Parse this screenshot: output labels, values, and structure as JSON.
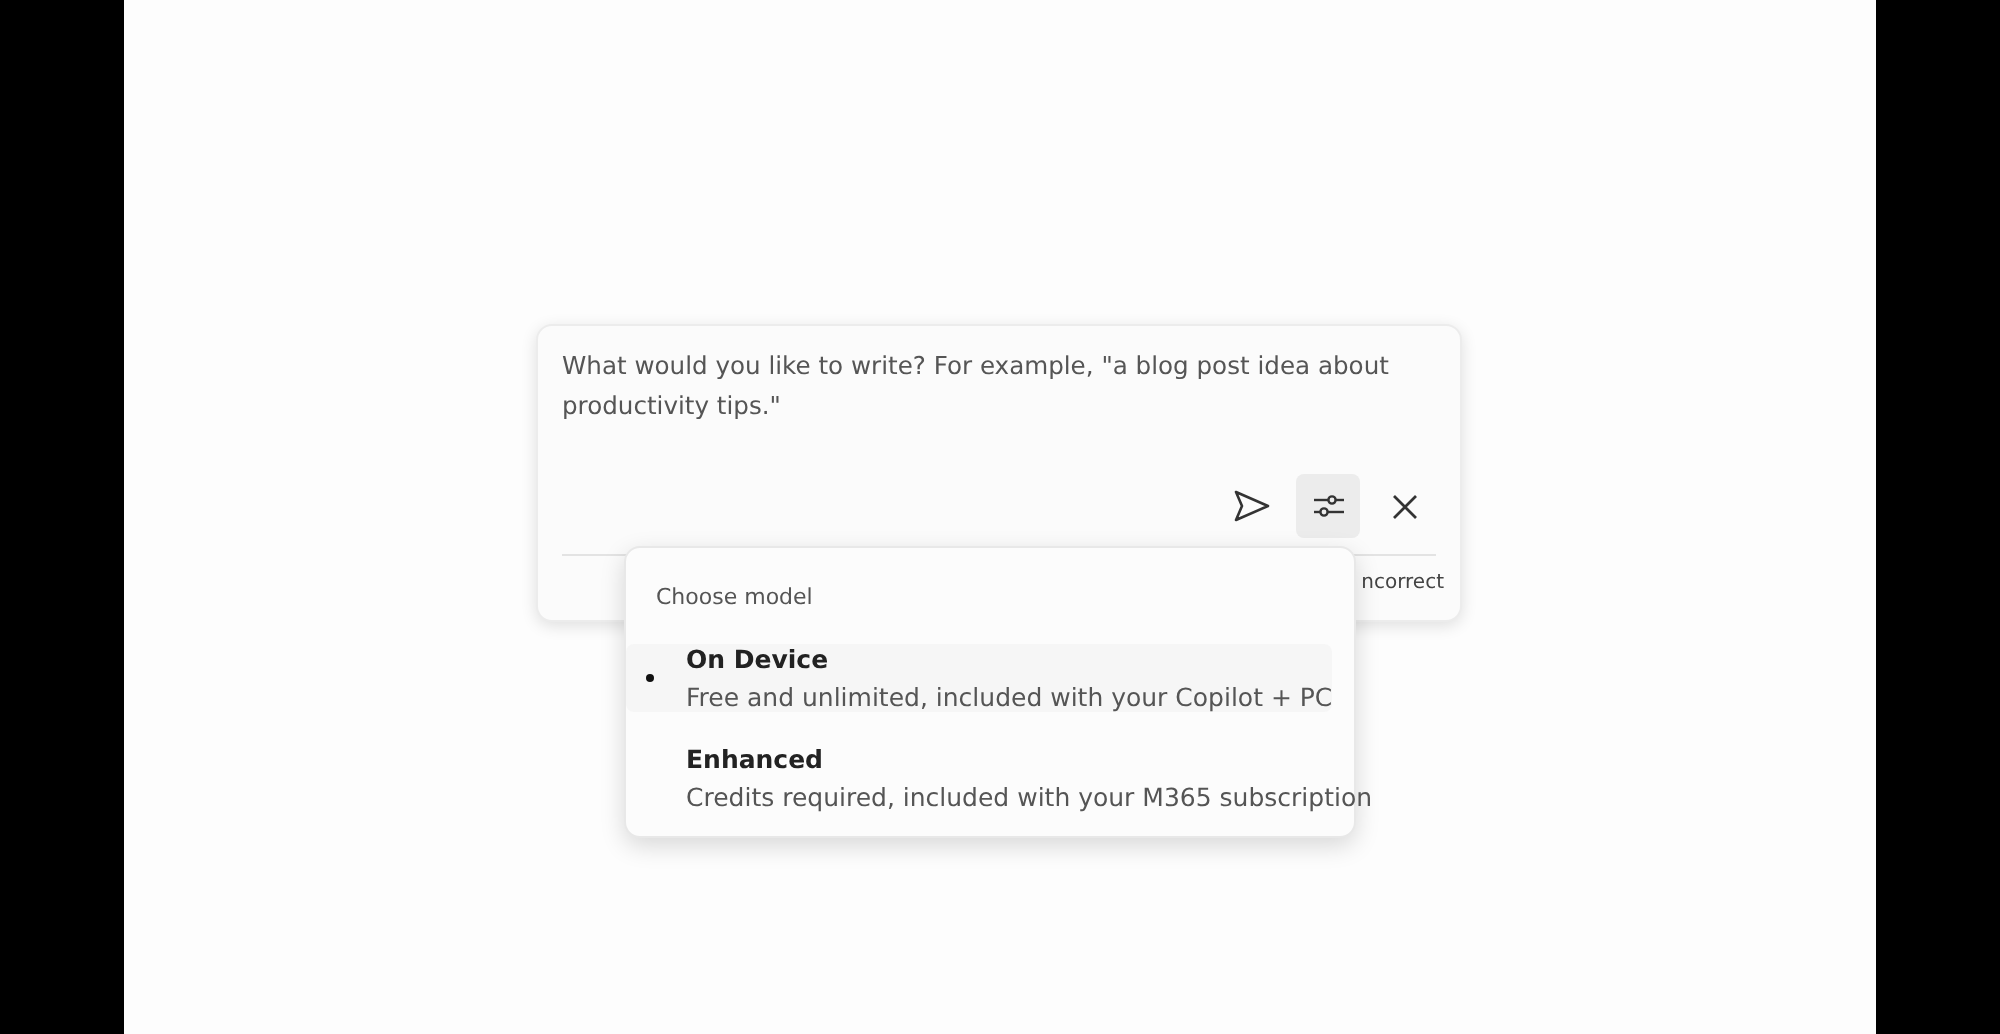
{
  "prompt": {
    "placeholder": "What would you like to write? For example, \"a blog post idea about productivity tips.\""
  },
  "toolbar": [
    {
      "kind": "send",
      "selected": false
    },
    {
      "kind": "settings",
      "selected": true
    },
    {
      "kind": "close",
      "selected": false
    }
  ],
  "footer": {
    "text": "ncorrect"
  },
  "model_menu": {
    "title": "Choose model",
    "items": [
      {
        "label": "On Device",
        "description": "Free and unlimited, included with your Copilot + PC",
        "selected": true
      },
      {
        "label": "Enhanced",
        "description": "Credits required, included with your M365 subscription",
        "selected": false
      }
    ]
  }
}
